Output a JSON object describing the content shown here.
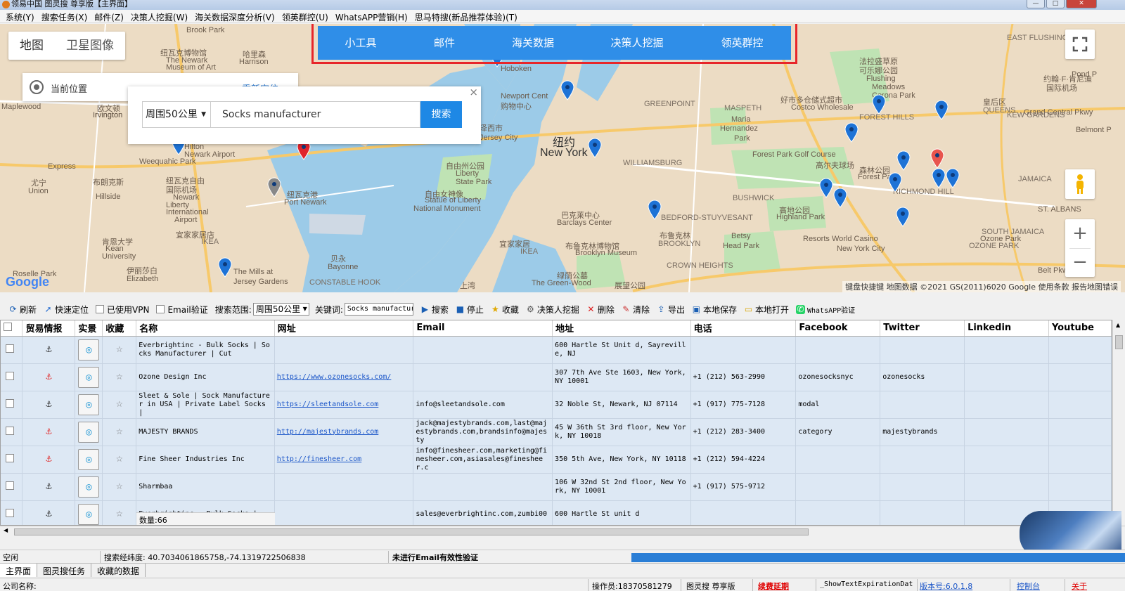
{
  "window": {
    "title": "领易中国 图灵搜 尊享版【主界面】",
    "minimize": "—",
    "maximize": "□",
    "close": "✕"
  },
  "menu": [
    "系统(Y)",
    "搜索任务(X)",
    "邮件(Z)",
    "决策人挖掘(W)",
    "海关数据深度分析(V)",
    "领英群控(U)",
    "WhatsAPP营销(H)",
    "思马特搜(新品推荐体验)(T)"
  ],
  "map": {
    "type_map": "地图",
    "type_satellite": "卫星图像",
    "current_location_label": "当前位置",
    "relocate_label": "重新定位",
    "search_range": "周围50公里",
    "search_query": "Socks manufacturer",
    "search_button": "搜索",
    "close": "×",
    "attribution": "键盘快捷键   地图数据 ©2021 GS(2011)6020 Google   使用条款   报告地图错误",
    "google_logo": "Google",
    "labels": [
      {
        "text": "Brook Park"
      },
      {
        "text": "纽瓦克博物馆"
      },
      {
        "text": "The Newark"
      },
      {
        "text": "Museum of Art"
      },
      {
        "text": "哈里森"
      },
      {
        "text": "Harrison"
      },
      {
        "text": "欧文顿"
      },
      {
        "text": "Irvington"
      },
      {
        "text": "Weequahic Park"
      },
      {
        "text": "纽瓦克自由"
      },
      {
        "text": "国际机场"
      },
      {
        "text": "Newark"
      },
      {
        "text": "Liberty"
      },
      {
        "text": "International"
      },
      {
        "text": "Airport"
      },
      {
        "text": "纽瓦克港"
      },
      {
        "text": "Port Newark"
      },
      {
        "text": "宜家家居店"
      },
      {
        "text": "IKEA"
      },
      {
        "text": "肯恩大学"
      },
      {
        "text": "Kean"
      },
      {
        "text": "University"
      },
      {
        "text": "伊丽莎白"
      },
      {
        "text": "Elizabeth"
      },
      {
        "text": "The Mills at"
      },
      {
        "text": "Jersey Gardens"
      },
      {
        "text": "贝永"
      },
      {
        "text": "Bayonne"
      },
      {
        "text": "自由州公园"
      },
      {
        "text": "Liberty"
      },
      {
        "text": "State Park"
      },
      {
        "text": "自由女神像"
      },
      {
        "text": "Statue of Liberty"
      },
      {
        "text": "National Monument"
      },
      {
        "text": "纽约"
      },
      {
        "text": "New York"
      },
      {
        "text": "泽西市"
      },
      {
        "text": "Jersey City"
      },
      {
        "text": "Newport Cent"
      },
      {
        "text": "购物中心"
      },
      {
        "text": "巴克莱中心"
      },
      {
        "text": "Barclays Center"
      },
      {
        "text": "布鲁克林博物馆"
      },
      {
        "text": "Brooklyn Museum"
      },
      {
        "text": "布鲁克林"
      },
      {
        "text": "BROOKLYN"
      },
      {
        "text": "宜家家居"
      },
      {
        "text": "IKEA"
      },
      {
        "text": "绿荫公墓"
      },
      {
        "text": "The Green-Wood"
      },
      {
        "text": "展望公园"
      },
      {
        "text": "Maria"
      },
      {
        "text": "Hernandez"
      },
      {
        "text": "Park"
      },
      {
        "text": "Forest Park Golf Course"
      },
      {
        "text": "高尔夫球场"
      },
      {
        "text": "森林公园"
      },
      {
        "text": "Forest Park"
      },
      {
        "text": "高地公园"
      },
      {
        "text": "Highland Park"
      },
      {
        "text": "Betsy"
      },
      {
        "text": "Head Park"
      },
      {
        "text": "Resorts World Casino"
      },
      {
        "text": "New York City"
      },
      {
        "text": "皇后区"
      },
      {
        "text": "QUEENS"
      },
      {
        "text": "好市多仓储式超市"
      },
      {
        "text": "Costco Wholesale"
      },
      {
        "text": "法拉盛草原"
      },
      {
        "text": "可乐娜公园"
      },
      {
        "text": "Flushing"
      },
      {
        "text": "Meadows"
      },
      {
        "text": "Corona Park"
      },
      {
        "text": "Belmont P"
      },
      {
        "text": "约翰·F·肯尼迪"
      },
      {
        "text": "国际机场"
      },
      {
        "text": "Roselle Park"
      },
      {
        "text": "尤宁"
      },
      {
        "text": "Union"
      },
      {
        "text": "布朗克斯"
      },
      {
        "text": "Irvington"
      },
      {
        "text": "Hoboken"
      },
      {
        "text": "Maplewood"
      },
      {
        "text": "Hillside"
      },
      {
        "text": "Grand Central Pkwy"
      },
      {
        "text": "EAST FLUSHING"
      },
      {
        "text": "FOREST HILLS"
      },
      {
        "text": "RICHMOND HILL"
      },
      {
        "text": "OZONE PARK"
      },
      {
        "text": "SOUTH JAMAICA"
      },
      {
        "text": "JAMAICA"
      },
      {
        "text": "ST. ALBANS"
      },
      {
        "text": "CROWN HEIGHTS"
      },
      {
        "text": "BEDFORD-STUYVESANT"
      },
      {
        "text": "GREENPOINT"
      },
      {
        "text": "WILLIAMSBURG"
      },
      {
        "text": "BUSHWICK"
      },
      {
        "text": "MASPETH"
      },
      {
        "text": "KEW GARDENS"
      },
      {
        "text": "CONSTABLE HOOK"
      },
      {
        "text": "上湾"
      },
      {
        "text": "Belt Pkwy"
      },
      {
        "text": "Express"
      },
      {
        "text": "Pond P"
      },
      {
        "text": "Hilton"
      },
      {
        "text": "Newark Airport"
      },
      {
        "text": "Ozone Park"
      }
    ]
  },
  "topnav": [
    "小工具",
    "邮件",
    "海关数据",
    "决策人挖掘",
    "领英群控"
  ],
  "toolbar": {
    "refresh": "刷新",
    "quick_locate": "快速定位",
    "vpn": "已使用VPN",
    "email_verify": "Email验证",
    "scope_label": "搜索范围:",
    "scope_value": "周围50公里",
    "keyword_label": "关键词:",
    "keyword_value": "Socks manufactur",
    "search": "搜索",
    "stop": "停止",
    "favorite": "收藏",
    "decision": "决策人挖掘",
    "delete": "删除",
    "clear": "清除",
    "export": "导出",
    "save_local": "本地保存",
    "open_local": "本地打开",
    "whatsapp": "WhatsAPP验证"
  },
  "table": {
    "columns": [
      "",
      "贸易情报",
      "实景",
      "收藏",
      "名称",
      "网址",
      "Email",
      "地址",
      "电话",
      "Facebook",
      "Twitter",
      "Linkedin",
      "Youtube"
    ],
    "rows": [
      {
        "intel": "⚓",
        "intel_color": "black",
        "name": "Everbrightinc - Bulk Socks | Socks Manufacturer | Cut",
        "url": "",
        "email": "",
        "address": "600 Hartle St Unit d, Sayreville, NJ",
        "phone": "",
        "facebook": "",
        "twitter": "",
        "linkedin": "",
        "youtube": ""
      },
      {
        "intel": "⚓",
        "intel_color": "red",
        "name": "Ozone Design Inc",
        "url": "https://www.ozonesocks.com/",
        "email": "",
        "address": "307 7th Ave Ste 1603, New York, NY 10001",
        "phone": "+1 (212) 563-2990",
        "facebook": "ozonesocksnyc",
        "twitter": "ozonesocks",
        "linkedin": "",
        "youtube": ""
      },
      {
        "intel": "⚓",
        "intel_color": "black",
        "name": "Sleet & Sole | Sock Manufacturer in USA | Private Label Socks |",
        "url": "https://sleetandsole.com",
        "email": "info@sleetandsole.com",
        "address": "32 Noble St, Newark, NJ 07114",
        "phone": "+1 (917) 775-7128",
        "facebook": "modal",
        "twitter": "",
        "linkedin": "",
        "youtube": ""
      },
      {
        "intel": "⚓",
        "intel_color": "red",
        "name": "MAJESTY BRANDS",
        "url": "http://majestybrands.com",
        "email": "jack@majestybrands.com,last@majestybrands.com,brandsinfo@majesty",
        "address": "45 W 36th St 3rd floor, New York, NY 10018",
        "phone": "+1 (212) 283-3400",
        "facebook": "category",
        "twitter": "majestybrands",
        "linkedin": "",
        "youtube": ""
      },
      {
        "intel": "⚓",
        "intel_color": "red",
        "name": "Fine Sheer Industries Inc",
        "url": "http://finesheer.com",
        "email": "info@finesheer.com,marketing@finesheer.com,asiasales@finesheer.c",
        "address": "350 5th Ave, New York, NY 10118",
        "phone": "+1 (212) 594-4224",
        "facebook": "",
        "twitter": "",
        "linkedin": "",
        "youtube": ""
      },
      {
        "intel": "⚓",
        "intel_color": "black",
        "name": "Sharmbaa",
        "url": "",
        "email": "",
        "address": "106 W 32nd St 2nd floor, New York, NY 10001",
        "phone": "+1 (917) 575-9712",
        "facebook": "",
        "twitter": "",
        "linkedin": "",
        "youtube": ""
      },
      {
        "intel": "⚓",
        "intel_color": "black",
        "name": "Everbrightinc - Bulk Socks |",
        "url": "",
        "email": "sales@everbrightinc.com,zumbi00",
        "address": "600 Hartle St unit d",
        "phone": "",
        "facebook": "",
        "twitter": "",
        "linkedin": "",
        "youtube": ""
      }
    ],
    "count_label": "数量:66"
  },
  "status": {
    "idle": "空闲",
    "coords": "搜索经纬度: 40.7034061865758,-74.1319722506838",
    "email_status": "未进行Email有效性验证"
  },
  "tabs": [
    "主界面",
    "图灵搜任务",
    "收藏的数据"
  ],
  "bottom": {
    "company_label": "公司名称:",
    "operator": "操作员:18370581279",
    "edition": "图灵搜 尊享版",
    "renew": "续费延期",
    "expiration": "_ShowTextExpirationDat",
    "version": "版本号:6.0.1.8",
    "console": "控制台",
    "close": "关于"
  },
  "colors": {
    "accent": "#2f8ee8",
    "nav_border": "#e7262a",
    "progress": "#2a7ed6",
    "row_bg": "#dde8f4",
    "renew": "#e00000"
  }
}
